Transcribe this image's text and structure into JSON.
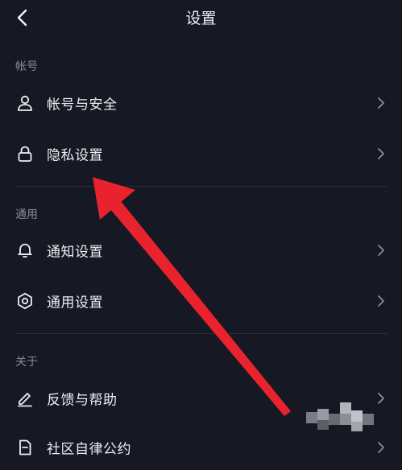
{
  "header": {
    "title": "设置",
    "back_icon": "chevron-left-icon"
  },
  "sections": [
    {
      "title": "帐号",
      "items": [
        {
          "label": "帐号与安全",
          "icon": "user-icon"
        },
        {
          "label": "隐私设置",
          "icon": "lock-icon"
        }
      ]
    },
    {
      "title": "通用",
      "items": [
        {
          "label": "通知设置",
          "icon": "bell-icon"
        },
        {
          "label": "通用设置",
          "icon": "gear-icon"
        }
      ]
    },
    {
      "title": "关于",
      "items": [
        {
          "label": "反馈与帮助",
          "icon": "edit-icon"
        },
        {
          "label": "社区自律公约",
          "icon": "document-icon"
        }
      ]
    }
  ],
  "colors": {
    "background": "#161823",
    "text": "#eeeef2",
    "section_text": "#8a8b93",
    "divider": "#2a2c36",
    "annotation_arrow": "#e8232d"
  }
}
